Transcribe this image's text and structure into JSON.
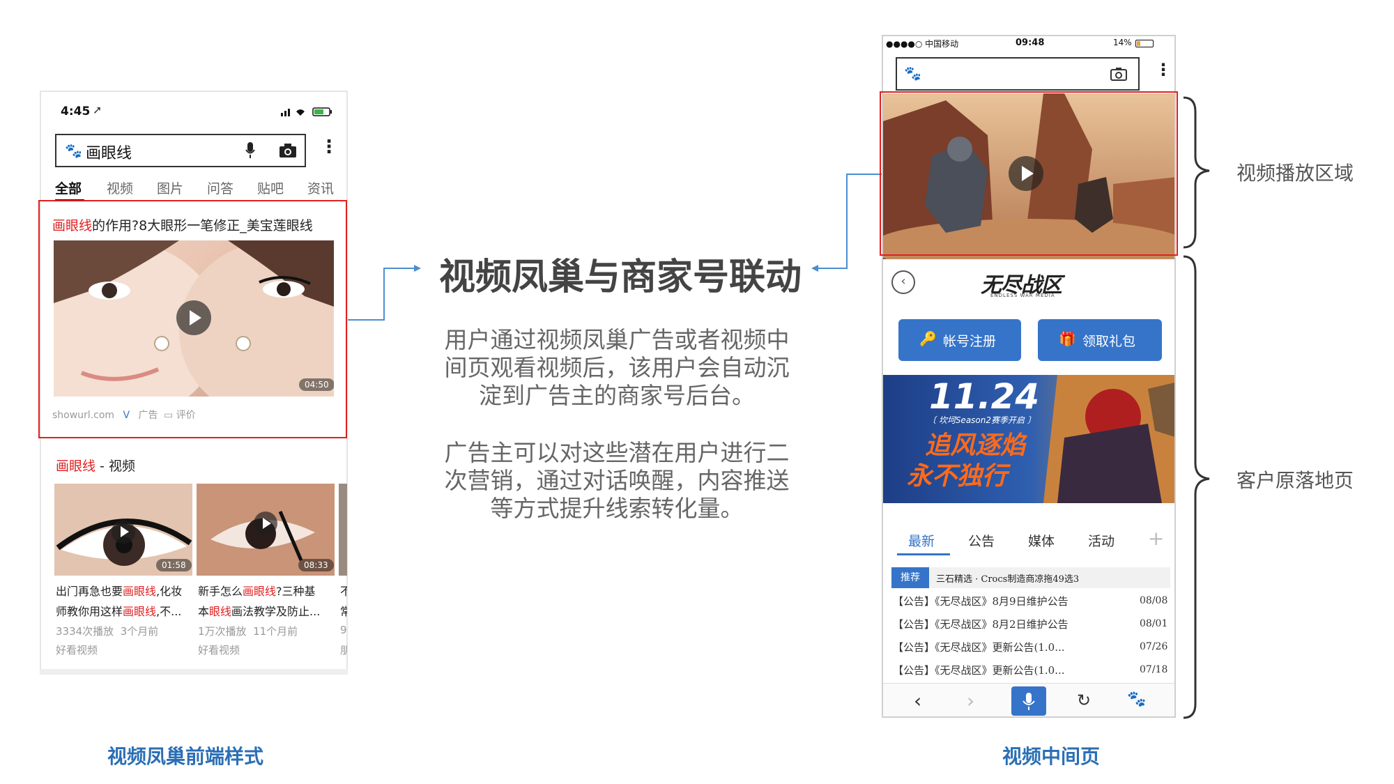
{
  "left_phone": {
    "status_time": "4:45",
    "search_query": "画眼线",
    "tabs": [
      "全部",
      "视频",
      "图片",
      "问答",
      "贴吧",
      "资讯"
    ],
    "result": {
      "title_highlight": "画眼线",
      "title_rest": "的作用?8大眼形一笔修正_美宝莲眼线",
      "duration": "04:50",
      "source": "showurl.com",
      "v_badge": "V",
      "ad_label": "广告",
      "comment_label": "评价"
    },
    "video_section": {
      "title_highlight": "画眼线",
      "title_rest": " - 视频",
      "items": [
        {
          "duration": "01:58",
          "line1_pre": "出门再急也要",
          "line1_hl": "画眼线",
          "line1_post": ",化妆",
          "line2_pre": "师教你用这样",
          "line2_hl": "画眼线",
          "line2_post": ",不...",
          "plays": "3334次播放",
          "age": "3个月前",
          "source": "好看视频"
        },
        {
          "duration": "08:33",
          "line1_pre": "新手怎么",
          "line1_hl": "画眼线",
          "line1_post": "?三种基",
          "line2_pre": "本",
          "line2_hl": "眼线",
          "line2_post": "画法教学及防止...",
          "plays": "1万次播放",
          "age": "11个月前",
          "source": "好看视频"
        }
      ],
      "third_partial": {
        "l1": "不",
        "l2": "常",
        "l3": "9",
        "l4": "朋"
      }
    }
  },
  "center": {
    "title": "视频凤巢与商家号联动",
    "para1": [
      "用户通过视频凤巢广告或者视频中",
      "间页观看视频后，该用户会自动沉",
      "淀到广告主的商家号后台。"
    ],
    "para2": [
      "广告主可以对这些潜在用户进行二",
      "次营销，通过对话唤醒，内容推送",
      "等方式提升线索转化量。"
    ]
  },
  "right_phone": {
    "carrier": "●●●●○ 中国移动",
    "time": "09:48",
    "battery": "14%",
    "game_logo": "无尽战区",
    "game_logo_sub": "ENDLESS WAR MEDIA",
    "register_button": "帐号注册",
    "gift_button": "领取礼包",
    "banner": {
      "date": "11.24",
      "subtitle": "〔 坎坷Season2赛季开启 〕",
      "line1": "追风逐焰",
      "line2": "永不独行"
    },
    "news_tabs": [
      "最新",
      "公告",
      "媒体",
      "活动"
    ],
    "recommend_badge": "推荐",
    "recommend_text": "三石精选 · Crocs制造商凉拖49选3",
    "news": [
      {
        "text": "【公告】《无尽战区》8月9日维护公告",
        "date": "08/08"
      },
      {
        "text": "【公告】《无尽战区》8月2日维护公告",
        "date": "08/01"
      },
      {
        "text": "【公告】《无尽战区》更新公告(1.0...",
        "date": "07/26"
      },
      {
        "text": "【公告】《无尽战区》更新公告(1.0...",
        "date": "07/18"
      }
    ]
  },
  "labels": {
    "video_area": "视频播放区域",
    "landing_page": "客户原落地页",
    "left_caption": "视频凤巢前端样式",
    "right_caption": "视频中间页"
  },
  "colors": {
    "highlight_red": "#e02020",
    "accent_blue": "#3674c9",
    "caption_blue": "#2a6fb5",
    "connector": "#4a8fd0"
  }
}
